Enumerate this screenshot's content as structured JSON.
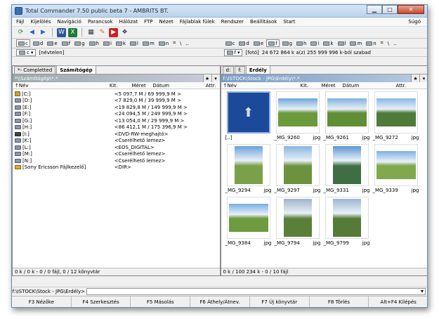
{
  "window": {
    "title": "Total Commander 7.50 public beta 7 - AMBRITS BT."
  },
  "menu": [
    "Fájl",
    "Kijelölés",
    "Navigáció",
    "Parancsok",
    "Hálózat",
    "FTP",
    "Nézet",
    "Fájlablak fülek",
    "Rendszer",
    "Beállítások",
    "Start"
  ],
  "menu_help": "Súgó",
  "toolbar_icons": [
    "refresh-icon",
    "back-icon",
    "forward-icon",
    "word-icon",
    "excel-icon",
    "calculator-icon",
    "paint-icon",
    "video-icon",
    "tree-icon"
  ],
  "drives_left": [
    "c",
    "d",
    "e",
    "f",
    "g",
    "h",
    "i",
    "k",
    "l",
    "m",
    "n"
  ],
  "drives_right": [
    "c",
    "d",
    "e",
    "f",
    "g",
    "h",
    "i",
    "k",
    "l",
    "m",
    "n"
  ],
  "left": {
    "drive_select": "c",
    "drive_label": "[névtelen]",
    "tabs": [
      "*- Completted",
      "Számítógép"
    ],
    "active_tab": 1,
    "path": "*\\\\Számítógép\\*.*",
    "columns": {
      "name": "↑Név",
      "ext": "Kit.",
      "size": "Méret",
      "date": "Dátum",
      "attr": "Attr."
    },
    "rows": [
      {
        "name": "[C:]",
        "size": "<5 097,7 M / 69 999,9 M >",
        "icon": "up"
      },
      {
        "name": "[D:]",
        "size": "<7 829,0 M / 39 999,9 M >",
        "icon": "drive"
      },
      {
        "name": "[E:]",
        "size": "<19 829,8 M / 149 999,9 M >",
        "icon": "drive"
      },
      {
        "name": "[F:]",
        "size": "<24 094,5 M / 249 999,9 M >",
        "icon": "drive"
      },
      {
        "name": "[G:]",
        "size": "<13 054,0 M / 29 999,9 M >",
        "icon": "drive"
      },
      {
        "name": "[H:]",
        "size": "<86 412,1 M / 175 396,9 M >",
        "icon": "drive"
      },
      {
        "name": "[I:]",
        "size": "<DVD-RW-meghajtó>",
        "icon": "dvd"
      },
      {
        "name": "[K:]",
        "size": "<Cserélhető lemez>",
        "icon": "drive"
      },
      {
        "name": "[L:]",
        "size": "<EOS_DIGITAL>",
        "icon": "drive"
      },
      {
        "name": "[M:]",
        "size": "<Cserélhető lemez>",
        "icon": "drive"
      },
      {
        "name": "[N:]",
        "size": "<Cserélhető lemez>",
        "icon": "drive"
      },
      {
        "name": "[Sony Ericsson Fájlkezelő]",
        "size": "<DIR>",
        "icon": "sony"
      }
    ],
    "status": "0 k / 0 k - 0 / 0 fájl, 0 / 12 könyvtár"
  },
  "right": {
    "drive_select": "f",
    "drive_label": "[fotó]",
    "drive_free": "24 672 864 k a(z) 255 999 996 k-ból szabad",
    "tabs": [
      "d:",
      "f:",
      "Erdély"
    ],
    "active_tab": 2,
    "path": "f:\\ISTOCK\\Stock - JPG\\Erdély\\*.*",
    "columns": {
      "name": "↑Név",
      "ext": "Kit.",
      "size": "Méret",
      "date": "Dátum",
      "attr": "Attr."
    },
    "thumbs": [
      {
        "name": "[..]",
        "ext": "",
        "type": "up"
      },
      {
        "name": "_MG_9260",
        "ext": "jpg",
        "type": "land",
        "sky": "#6fa6dc",
        "ground": "#6a9a3c"
      },
      {
        "name": "_MG_9261",
        "ext": "jpg",
        "type": "land",
        "sky": "#7fb2e0",
        "ground": "#5f8e35"
      },
      {
        "name": "_MG_9272",
        "ext": "jpg",
        "type": "land",
        "sky": "#88b8e6",
        "ground": "#4e7a3a"
      },
      {
        "name": "_MG_9294",
        "ext": "jpg",
        "type": "portrait",
        "sky": "#6aa2d8",
        "ground": "#7aa04a"
      },
      {
        "name": "_MG_9297",
        "ext": "jpg",
        "type": "portrait",
        "sky": "#8ab6e0",
        "ground": "#6c9240"
      },
      {
        "name": "_MG_9331",
        "ext": "jpg",
        "type": "portrait",
        "sky": "#5d96d2",
        "ground": "#3f6e44"
      },
      {
        "name": "_MG_9339",
        "ext": "jpg",
        "type": "land",
        "sky": "#7eb0e0",
        "ground": "#82a84e"
      },
      {
        "name": "_MG_9384",
        "ext": "jpg",
        "type": "land",
        "sky": "#78aedf",
        "ground": "#6e9a40"
      },
      {
        "name": "_MG_9794",
        "ext": "jpg",
        "type": "portrait",
        "sky": "#a0b4c8",
        "ground": "#5a7f3a"
      },
      {
        "name": "_MG_9799",
        "ext": "jpg",
        "type": "portrait",
        "sky": "#9ab6d2",
        "ground": "#567a38"
      }
    ],
    "status": "0 k / 100 234 k - 0 / 10 fájl"
  },
  "cmdline": {
    "prompt": "f:\\ISTOCK\\Stock - JPG\\Erdély>"
  },
  "fkeys": [
    "F3 Nézőke",
    "F4 Szerkesztés",
    "F5 Másolás",
    "F6 Áthely/Átnev.",
    "F7 Új könyvtár",
    "F8 Törlés",
    "Alt+F4 Kilépés"
  ]
}
